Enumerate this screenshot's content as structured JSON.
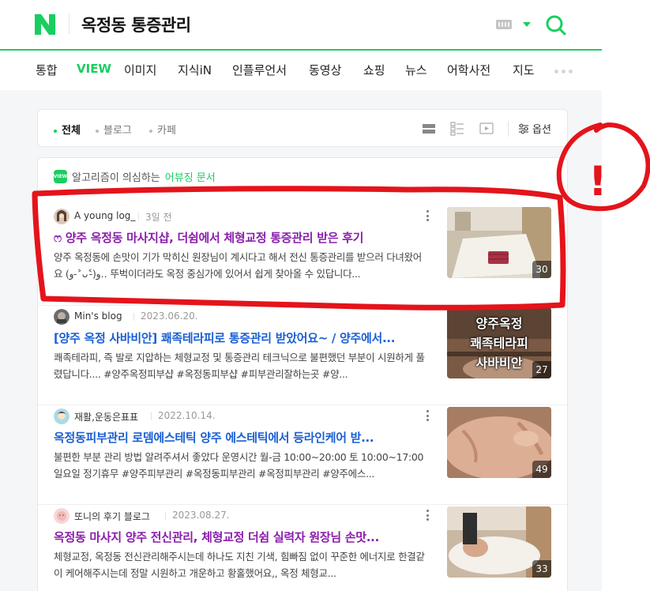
{
  "header": {
    "logo_letter": "N",
    "query": "옥정동 통증관리"
  },
  "tabs": [
    {
      "label": "통합",
      "active": false
    },
    {
      "label": "VIEW",
      "active": true
    },
    {
      "label": "이미지",
      "active": false
    },
    {
      "label": "지식iN",
      "active": false
    },
    {
      "label": "인플루언서",
      "active": false
    },
    {
      "label": "동영상",
      "active": false
    },
    {
      "label": "쇼핑",
      "active": false
    },
    {
      "label": "뉴스",
      "active": false
    },
    {
      "label": "어학사전",
      "active": false
    },
    {
      "label": "지도",
      "active": false
    }
  ],
  "filters": {
    "all": "전체",
    "blog": "블로그",
    "cafe": "카페",
    "options": "옵션"
  },
  "notice": {
    "badge": "VIEW",
    "text": "알고리즘이 의심하는",
    "link": "어뷰징 문서"
  },
  "results": [
    {
      "author": "A young log_",
      "date": "3일 전",
      "title": "ෆ 양주 옥정동 마사지샵, 더쉼에서 체형교정 통증관리 받은 후기",
      "desc": "양주 옥정동에 손맛이 기가 막히신 원장님이 계시다고 해서 전신 통증관리를 받으러 다녀왔어요 (و ˃̵ᴗ˂̵)و.. 뚜벅이더라도 옥정 중심가에 있어서 쉽게 찾아올 수 있답니다...",
      "count": "30",
      "visited": true
    },
    {
      "author": "Min's blog",
      "date": "2023.06.20.",
      "title": "[양주 옥정 사바비안] 쾌족테라피로 통증관리 받았어요~ / 양주에서...",
      "desc": "쾌족테라피, 즉 발로 지압하는 체형교정 및 통증관리 테크닉으로 불편했던 부분이 시원하게 풀렸답니다.... #양주옥정피부샵 #옥정동피부샵 #피부관리잘하는곳 #양...",
      "count": "27",
      "thumb_text": "양주옥정\n쾌족테라피\n사바비안",
      "visited": false
    },
    {
      "author": "재활,운동은표표",
      "date": "2022.10.14.",
      "title": "옥정동피부관리 로뎀에스테틱 양주 에스테틱에서 등라인케어 받...",
      "desc": "불편한 부분 관리 방법 알려주셔서 좋았다 운영시간 월-금 10:00~20:00 토 10:00~17:00 일요일 정기휴무 #양주피부관리 #옥정동피부관리 #옥정피부관리 #양주에스...",
      "count": "49",
      "visited": false
    },
    {
      "author": "또니의 후기 블로그",
      "date": "2023.08.27.",
      "title": "옥정동 마사지 양주 전신관리, 체형교정 더쉼 실력자 원장님 손맛...",
      "desc": "체형교정, 옥정동 전신관리해주시는데 하나도 지친 기색, 힘빠짐 없이 꾸준한 에너지로 한결같이 케어해주시는데 정말 시원하고 개운하고 황홀했어요,, 옥정 체형교...",
      "count": "33",
      "visited": true
    }
  ],
  "annotation": {
    "label": "!",
    "color": "#e4141b"
  }
}
